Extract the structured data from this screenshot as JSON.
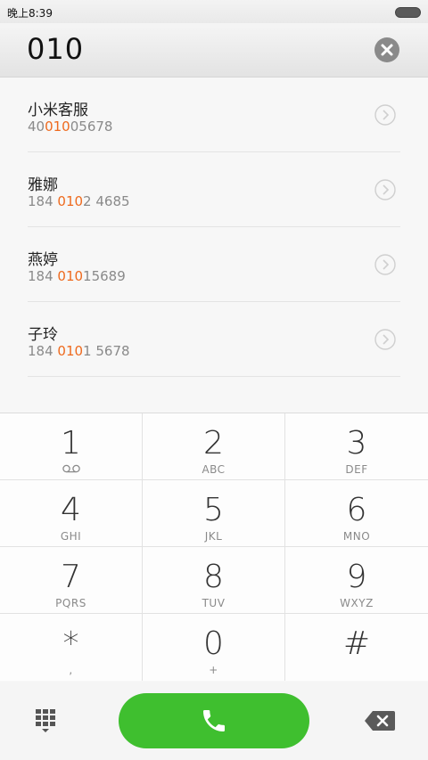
{
  "status": {
    "time": "晚上8:39"
  },
  "input": {
    "number": "010"
  },
  "results": [
    {
      "name": "小米客服",
      "num_pre": "40",
      "num_hl": "010",
      "num_post": "05678"
    },
    {
      "name": "雅娜",
      "num_pre": "184 ",
      "num_hl": "010",
      "num_post": "2 4685"
    },
    {
      "name": "燕婷",
      "num_pre": "184 ",
      "num_hl": "010",
      "num_post": "15689"
    },
    {
      "name": "子玲",
      "num_pre": "184 ",
      "num_hl": "010",
      "num_post": "1 5678"
    }
  ],
  "keypad": {
    "k1": {
      "digit": "1",
      "letters": ""
    },
    "k2": {
      "digit": "2",
      "letters": "ABC"
    },
    "k3": {
      "digit": "3",
      "letters": "DEF"
    },
    "k4": {
      "digit": "4",
      "letters": "GHI"
    },
    "k5": {
      "digit": "5",
      "letters": "JKL"
    },
    "k6": {
      "digit": "6",
      "letters": "MNO"
    },
    "k7": {
      "digit": "7",
      "letters": "PQRS"
    },
    "k8": {
      "digit": "8",
      "letters": "TUV"
    },
    "k9": {
      "digit": "9",
      "letters": "WXYZ"
    },
    "kstar": {
      "digit": "*",
      "letters": ","
    },
    "k0": {
      "digit": "0",
      "letters": "+"
    },
    "khash": {
      "digit": "#",
      "letters": ""
    }
  },
  "colors": {
    "accent": "#3fbf2f",
    "highlight": "#ee6a1e"
  },
  "icons": {
    "clear": "clear-circle-icon",
    "detail": "chevron-right-circle-icon",
    "voicemail": "voicemail-icon",
    "keypad": "dialpad-icon",
    "call": "phone-icon",
    "backspace": "backspace-icon"
  }
}
